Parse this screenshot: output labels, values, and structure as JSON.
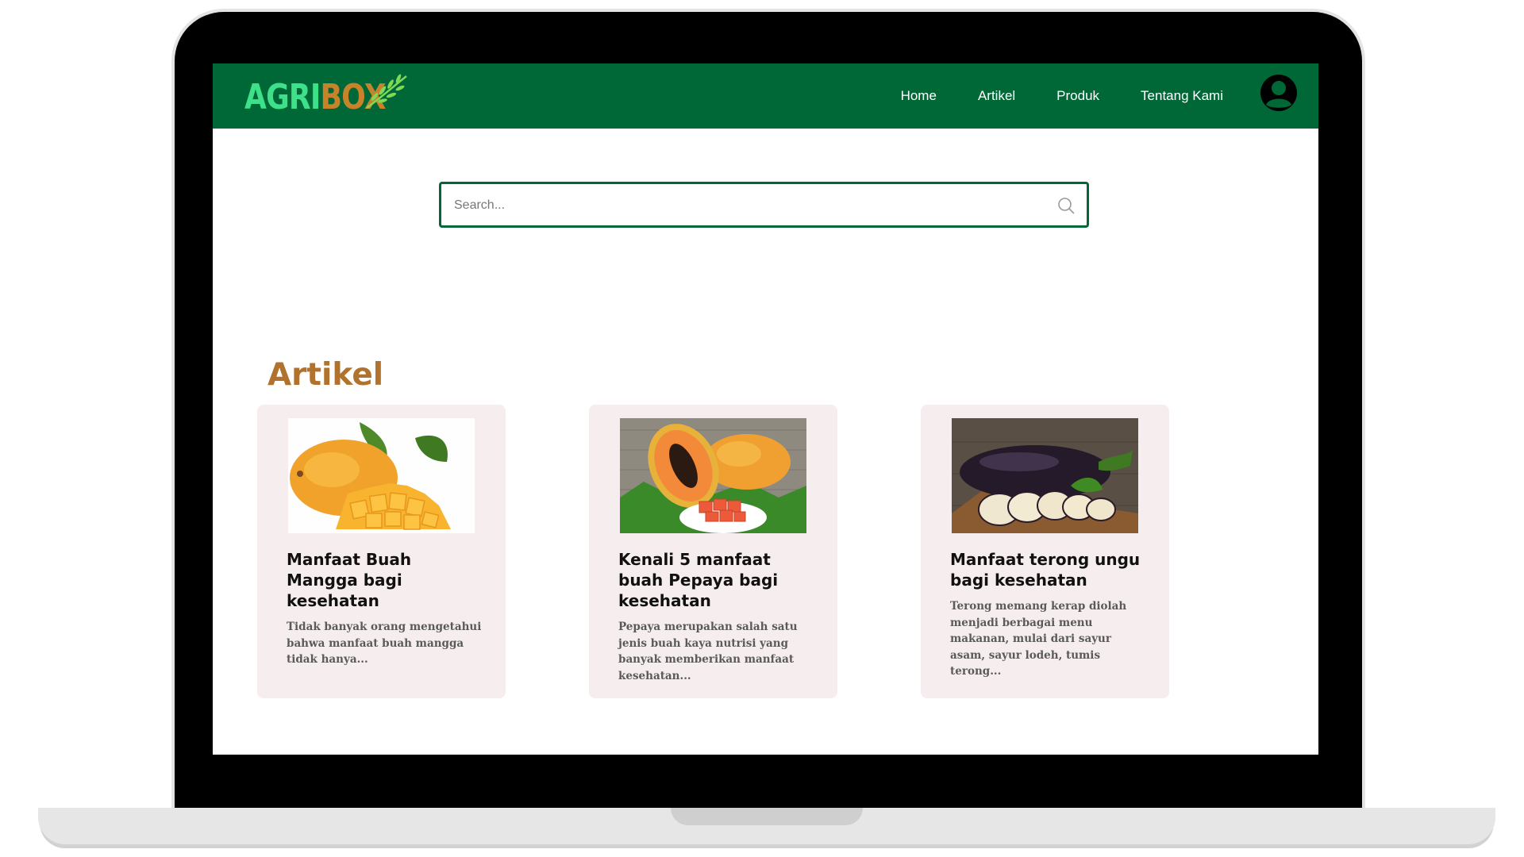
{
  "brand": {
    "part1": "AGRI",
    "part2": "BOX"
  },
  "nav": {
    "links": [
      "Home",
      "Artikel",
      "Produk",
      "Tentang Kami"
    ]
  },
  "search": {
    "placeholder": "Search..."
  },
  "section": {
    "title": "Artikel"
  },
  "articles": [
    {
      "title": "Manfaat Buah Mangga bagi kesehatan",
      "excerpt": "Tidak banyak orang mengetahui bahwa manfaat buah mangga tidak hanya...",
      "image": "mango"
    },
    {
      "title": "Kenali 5 manfaat buah Pepaya bagi kesehatan",
      "excerpt": "Pepaya merupakan salah satu jenis buah kaya nutrisi yang banyak memberikan manfaat kesehatan...",
      "image": "papaya"
    },
    {
      "title": "Manfaat terong ungu bagi kesehatan",
      "excerpt": "Terong memang kerap diolah menjadi berbagai menu makanan, mulai dari sayur asam, sayur lodeh, tumis terong...",
      "image": "eggplant"
    }
  ],
  "colors": {
    "nav_bg": "#006837",
    "accent_title": "#b0722c",
    "card_bg": "#f6eeee",
    "logo_green": "#3ee08a",
    "logo_brown": "#c8832a"
  }
}
